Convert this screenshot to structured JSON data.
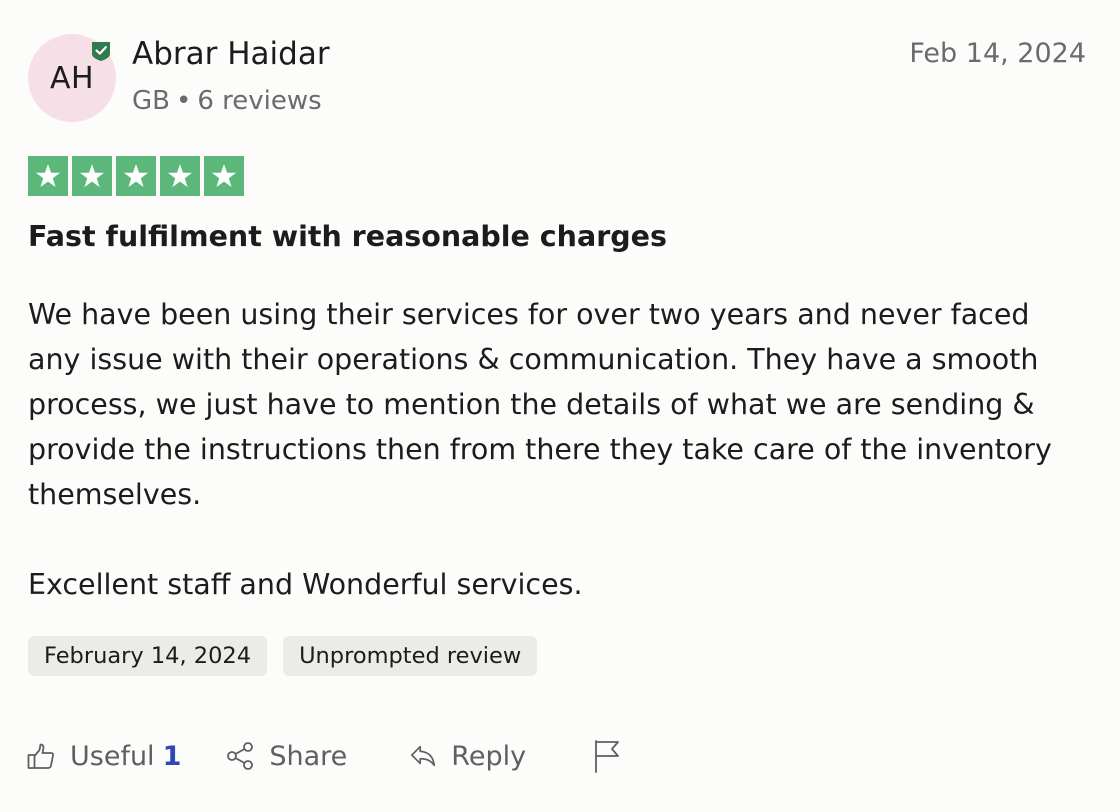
{
  "reviewer": {
    "initials": "AH",
    "name": "Abrar Haidar",
    "country": "GB",
    "separator": "•",
    "reviews": "6 reviews",
    "avatar_color": "#f6dfe6",
    "verified_color": "#2f7a4f"
  },
  "review": {
    "date": "Feb 14, 2024",
    "rating": 5,
    "star_color": "#5cb87a",
    "title": "Fast fulfilment with reasonable charges",
    "paragraphs": [
      "We have been using their services for over two years and never faced any issue with their operations & communication. They have a smooth process, we just have to mention the details of what we are sending & provide the instructions then from there they take care of the inventory themselves.",
      "Excellent staff and Wonderful services."
    ],
    "tags": [
      "February 14, 2024",
      "Unprompted review"
    ]
  },
  "actions": {
    "useful_label": "Useful",
    "useful_count": "1",
    "share_label": "Share",
    "reply_label": "Reply",
    "icons": [
      "thumbs-up-icon",
      "share-icon",
      "reply-icon",
      "flag-icon"
    ]
  }
}
